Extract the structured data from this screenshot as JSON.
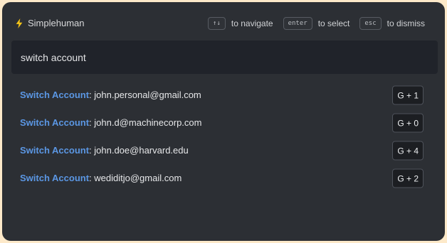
{
  "header": {
    "brand_name": "Simplehuman",
    "hints": [
      {
        "key": "↑↓",
        "text": "to navigate"
      },
      {
        "key": "enter",
        "text": "to select"
      },
      {
        "key": "esc",
        "text": "to dismiss"
      }
    ]
  },
  "search": {
    "value": "switch account"
  },
  "results": [
    {
      "action": "Switch Account",
      "separator": ": ",
      "email": "john.personal@gmail.com",
      "shortcut": "G + 1"
    },
    {
      "action": "Switch Account",
      "separator": ": ",
      "email": "john.d@machinecorp.com",
      "shortcut": "G + 0"
    },
    {
      "action": "Switch Account",
      "separator": ": ",
      "email": "john.doe@harvard.edu",
      "shortcut": "G + 4"
    },
    {
      "action": "Switch Account",
      "separator": ": ",
      "email": "wedi­ditjo@gmail.com",
      "shortcut": "G + 2"
    }
  ],
  "colors": {
    "accent": "#5b97e4",
    "bolt": "#f5c518",
    "background": "#fde9c9",
    "panel": "#2c2f34"
  },
  "icons": {
    "brand": "lightning-bolt-icon"
  }
}
